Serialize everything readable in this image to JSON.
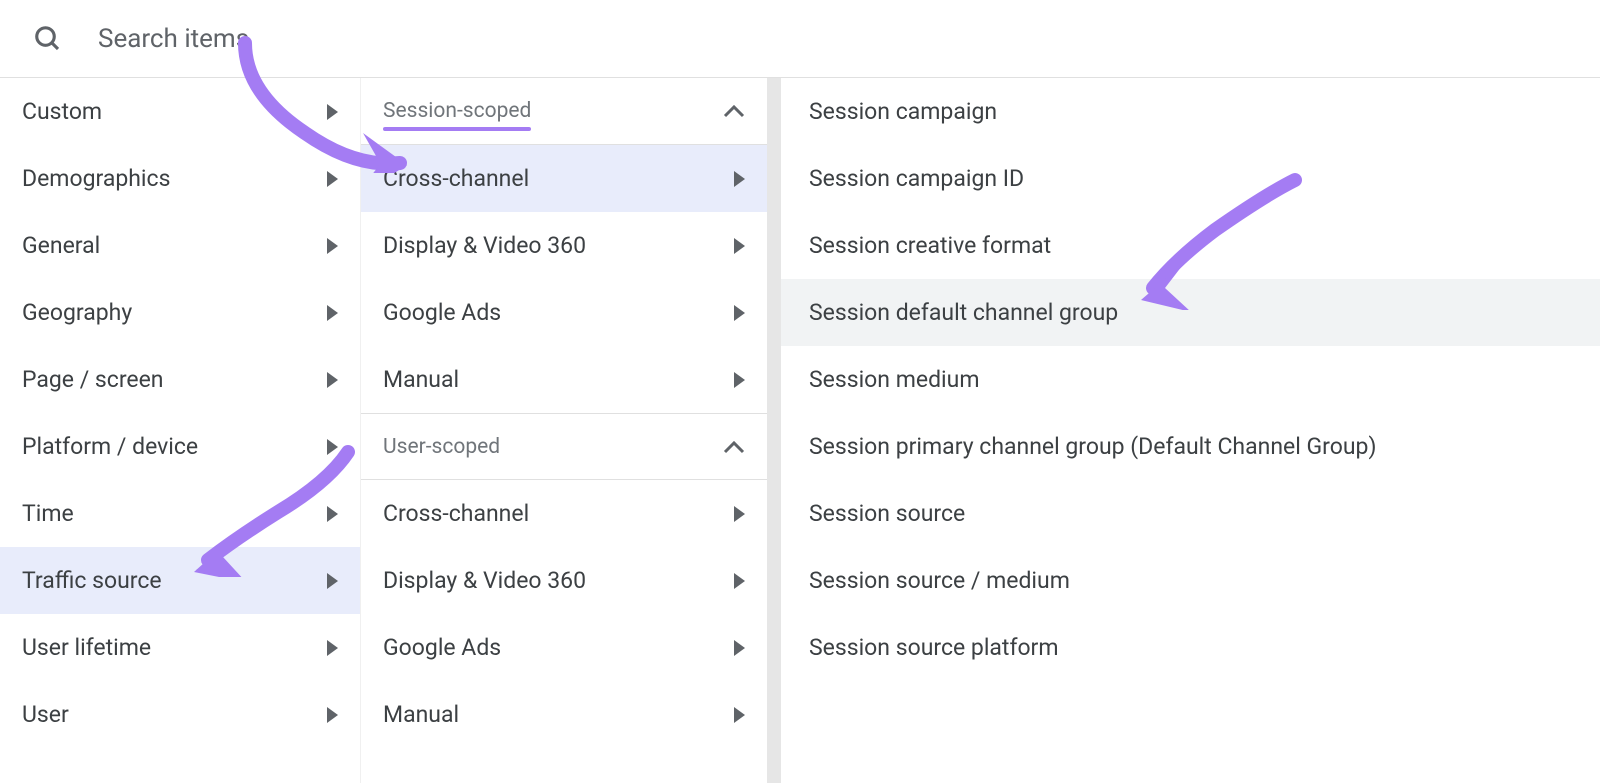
{
  "search": {
    "placeholder": "Search items"
  },
  "col1": {
    "items": [
      {
        "label": "Custom",
        "selected": false
      },
      {
        "label": "Demographics",
        "selected": false
      },
      {
        "label": "General",
        "selected": false
      },
      {
        "label": "Geography",
        "selected": false
      },
      {
        "label": "Page / screen",
        "selected": false
      },
      {
        "label": "Platform / device",
        "selected": false
      },
      {
        "label": "Time",
        "selected": false
      },
      {
        "label": "Traffic source",
        "selected": true
      },
      {
        "label": "User lifetime",
        "selected": false
      },
      {
        "label": "User",
        "selected": false
      }
    ]
  },
  "col2": {
    "session_header": "Session-scoped",
    "user_header": "User-scoped",
    "session_items": [
      {
        "label": "Cross-channel",
        "selected": true
      },
      {
        "label": "Display & Video 360",
        "selected": false
      },
      {
        "label": "Google Ads",
        "selected": false
      },
      {
        "label": "Manual",
        "selected": false
      }
    ],
    "user_items": [
      {
        "label": "Cross-channel",
        "selected": false
      },
      {
        "label": "Display & Video 360",
        "selected": false
      },
      {
        "label": "Google Ads",
        "selected": false
      },
      {
        "label": "Manual",
        "selected": false
      }
    ]
  },
  "col3": {
    "items": [
      {
        "label": "Session campaign",
        "highlighted": false
      },
      {
        "label": "Session campaign ID",
        "highlighted": false
      },
      {
        "label": "Session creative format",
        "highlighted": false
      },
      {
        "label": "Session default channel group",
        "highlighted": true
      },
      {
        "label": "Session medium",
        "highlighted": false
      },
      {
        "label": "Session primary channel group (Default Channel Group)",
        "highlighted": false
      },
      {
        "label": "Session source",
        "highlighted": false
      },
      {
        "label": "Session source / medium",
        "highlighted": false
      },
      {
        "label": "Session source platform",
        "highlighted": false
      }
    ]
  },
  "colors": {
    "purple": "#a47cf3",
    "selected_bg": "#e8ecfb",
    "highlight_bg": "#f1f3f4"
  }
}
